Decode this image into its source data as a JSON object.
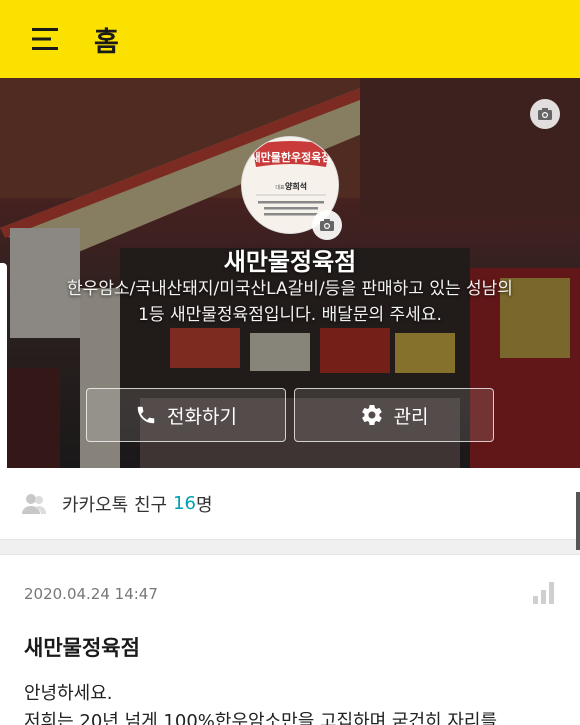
{
  "header": {
    "title": "홈",
    "menu_icon": "hamburger-menu-icon",
    "background_color": "#fae100"
  },
  "profile": {
    "logo_text": "새만물한우정육점",
    "logo_owner_label": "대표",
    "logo_owner_name": "양희석",
    "store_name": "새만물정육점",
    "description": "한우암소/국내산돼지/미국산LA갈비/등을 판매하고 있는 성남의 1등 새만물정육점입니다. 배달문의 주세요.",
    "cover_camera_icon": "camera-icon",
    "profile_camera_icon": "camera-icon"
  },
  "actions": {
    "call_label": "전화하기",
    "call_icon": "phone-icon",
    "manage_label": "관리",
    "manage_icon": "gear-icon"
  },
  "friends": {
    "label": "카카오톡 친구",
    "count": "16",
    "unit": "명",
    "count_color": "#00a0b4"
  },
  "post": {
    "date": "2020.04.24 14:47",
    "title": "새만물정육점",
    "body_line1": "안녕하세요.",
    "body_line2": "저희는 20년 넘게 100%한우암소만을 고집하며 굳건히 자리를",
    "stats_icon": "bar-chart-icon"
  }
}
